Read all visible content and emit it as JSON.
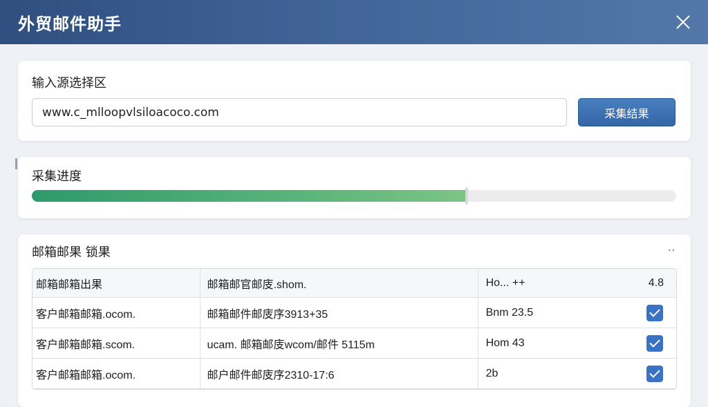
{
  "window": {
    "title": "外贸邮件助手"
  },
  "input_section": {
    "title": "输入源选择区",
    "url_value": "www.c_mlloopvlsiloacoco.com",
    "collect_button": "采集结果"
  },
  "progress_section": {
    "title": "采集进度",
    "progress": 0.675
  },
  "results_section": {
    "title": "邮箱邮果 锁果",
    "more_label": "··",
    "headers": [
      "邮箱邮箱出果",
      "邮箱邮官邮庋.shom.",
      "Ho... ++",
      "4.8"
    ],
    "rows": [
      {
        "col1": "客户邮箱邮箱.ocom.",
        "col2": "邮箱邮件邮庋序3913+35",
        "col3": "Bnm 23.5",
        "checked": true
      },
      {
        "col1": "客户邮箱邮箱.scom.",
        "col2": "ucam. 邮箱邮庋wcom/邮件 5115m",
        "col3": "Hom 43",
        "checked": true
      },
      {
        "col1": "客户邮箱邮箱.ocom.",
        "col2": "邮户邮件邮庋序2310-17:6",
        "col3": "2b",
        "checked": true
      }
    ]
  },
  "colors": {
    "titlebar": "#44679b",
    "accent": "#3a72c4",
    "progress": "#59b37a"
  }
}
